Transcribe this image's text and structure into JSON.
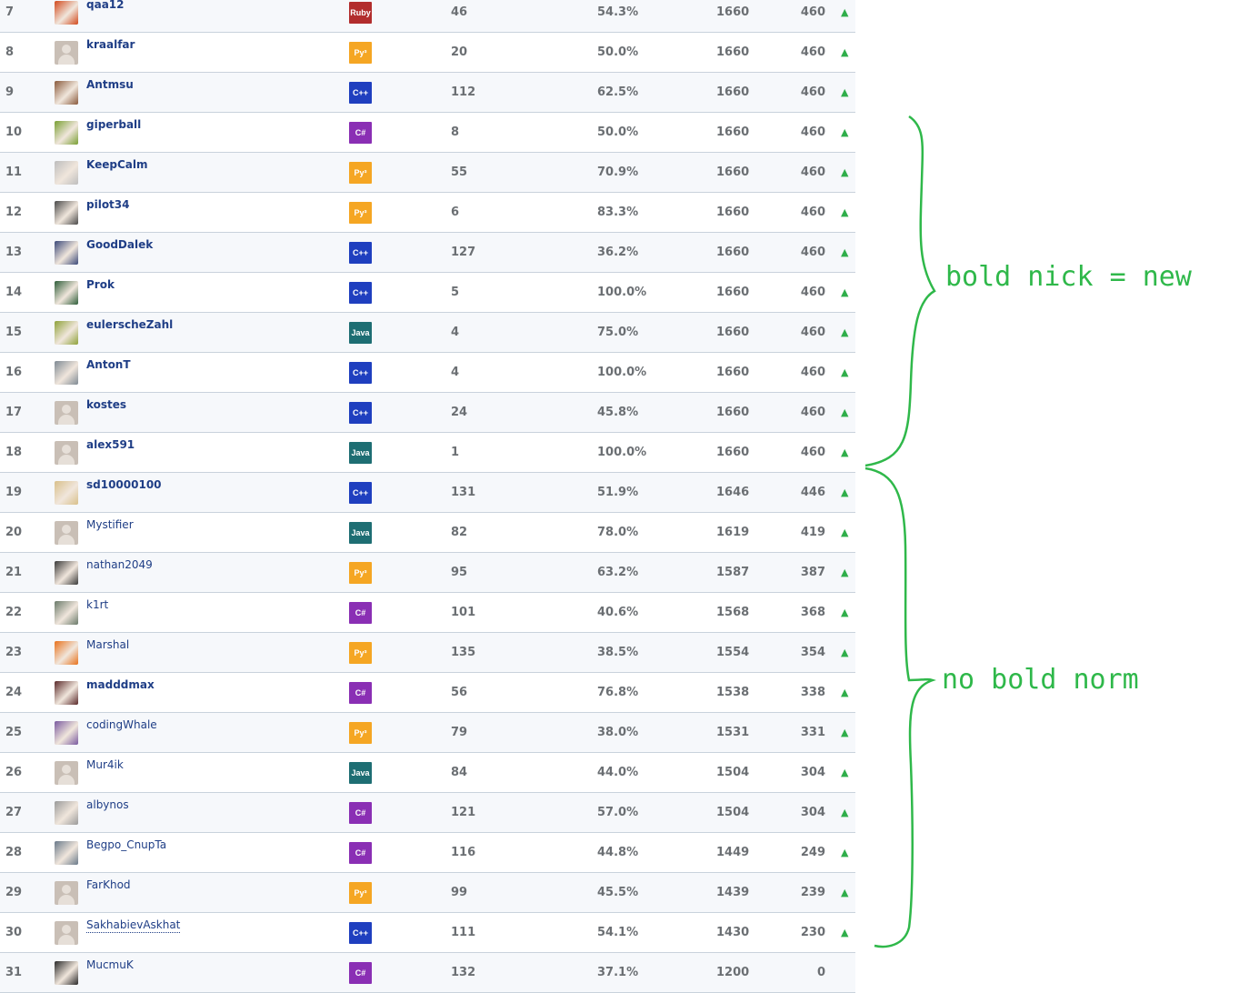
{
  "language_colors": {
    "Ruby": "#b22d2d",
    "Py": "#f5a623",
    "C++": "#1f3fbf",
    "C#": "#8a2fb4",
    "Java": "#1e6e73"
  },
  "rows": [
    {
      "rank": "7",
      "nick": "qaa12",
      "bold": true,
      "lang": "Ruby",
      "lang_label": "Ruby",
      "tasks": "46",
      "pct": "54.3%",
      "rating": "1660",
      "points": "460",
      "trend": "▲",
      "avatar": "dark-eye-avatar",
      "avatar_color": "#d24a1d"
    },
    {
      "rank": "8",
      "nick": "kraalfar",
      "bold": true,
      "lang": "Py",
      "lang_label": "Py³",
      "tasks": "20",
      "pct": "50.0%",
      "rating": "1660",
      "points": "460",
      "trend": "▲",
      "avatar": "default-avatar"
    },
    {
      "rank": "9",
      "nick": "Antmsu",
      "bold": true,
      "lang": "C++",
      "lang_label": "C++",
      "tasks": "112",
      "pct": "62.5%",
      "rating": "1660",
      "points": "460",
      "trend": "▲",
      "avatar": "photo-avatar",
      "avatar_color": "#8a5a3c"
    },
    {
      "rank": "10",
      "nick": "giperball",
      "bold": true,
      "lang": "C#",
      "lang_label": "C#",
      "tasks": "8",
      "pct": "50.0%",
      "rating": "1660",
      "points": "460",
      "trend": "▲",
      "avatar": "photo-avatar",
      "avatar_color": "#7aa034"
    },
    {
      "rank": "11",
      "nick": "KeepCalm",
      "bold": true,
      "lang": "Py",
      "lang_label": "Py³",
      "tasks": "55",
      "pct": "70.9%",
      "rating": "1660",
      "points": "460",
      "trend": "▲",
      "avatar": "photo-avatar",
      "avatar_color": "#bdbdbd"
    },
    {
      "rank": "12",
      "nick": "pilot34",
      "bold": true,
      "lang": "Py",
      "lang_label": "Py³",
      "tasks": "6",
      "pct": "83.3%",
      "rating": "1660",
      "points": "460",
      "trend": "▲",
      "avatar": "photo-avatar",
      "avatar_color": "#4a4a4a"
    },
    {
      "rank": "13",
      "nick": "GoodDalek",
      "bold": true,
      "lang": "C++",
      "lang_label": "C++",
      "tasks": "127",
      "pct": "36.2%",
      "rating": "1660",
      "points": "460",
      "trend": "▲",
      "avatar": "photo-avatar",
      "avatar_color": "#3c4a7a"
    },
    {
      "rank": "14",
      "nick": "Prok",
      "bold": true,
      "lang": "C++",
      "lang_label": "C++",
      "tasks": "5",
      "pct": "100.0%",
      "rating": "1660",
      "points": "460",
      "trend": "▲",
      "avatar": "photo-avatar",
      "avatar_color": "#2f5e3a"
    },
    {
      "rank": "15",
      "nick": "eulerscheZahl",
      "bold": true,
      "lang": "Java",
      "lang_label": "Java",
      "tasks": "4",
      "pct": "75.0%",
      "rating": "1660",
      "points": "460",
      "trend": "▲",
      "avatar": "photo-avatar",
      "avatar_color": "#8fa23a"
    },
    {
      "rank": "16",
      "nick": "AntonT",
      "bold": true,
      "lang": "C++",
      "lang_label": "C++",
      "tasks": "4",
      "pct": "100.0%",
      "rating": "1660",
      "points": "460",
      "trend": "▲",
      "avatar": "photo-avatar",
      "avatar_color": "#7f8a94"
    },
    {
      "rank": "17",
      "nick": "kostes",
      "bold": true,
      "lang": "C++",
      "lang_label": "C++",
      "tasks": "24",
      "pct": "45.8%",
      "rating": "1660",
      "points": "460",
      "trend": "▲",
      "avatar": "default-avatar"
    },
    {
      "rank": "18",
      "nick": "alex591",
      "bold": true,
      "lang": "Java",
      "lang_label": "Java",
      "tasks": "1",
      "pct": "100.0%",
      "rating": "1660",
      "points": "460",
      "trend": "▲",
      "avatar": "default-avatar"
    },
    {
      "rank": "19",
      "nick": "sd10000100",
      "bold": true,
      "lang": "C++",
      "lang_label": "C++",
      "tasks": "131",
      "pct": "51.9%",
      "rating": "1646",
      "points": "446",
      "trend": "▲",
      "avatar": "photo-avatar",
      "avatar_color": "#d9c08a"
    },
    {
      "rank": "20",
      "nick": "Mystifier",
      "bold": false,
      "lang": "Java",
      "lang_label": "Java",
      "tasks": "82",
      "pct": "78.0%",
      "rating": "1619",
      "points": "419",
      "trend": "▲",
      "avatar": "default-avatar"
    },
    {
      "rank": "21",
      "nick": "nathan2049",
      "bold": false,
      "lang": "Py",
      "lang_label": "Py³",
      "tasks": "95",
      "pct": "63.2%",
      "rating": "1587",
      "points": "387",
      "trend": "▲",
      "avatar": "photo-avatar",
      "avatar_color": "#3a3a3a"
    },
    {
      "rank": "22",
      "nick": "k1rt",
      "bold": false,
      "lang": "C#",
      "lang_label": "C#",
      "tasks": "101",
      "pct": "40.6%",
      "rating": "1568",
      "points": "368",
      "trend": "▲",
      "avatar": "photo-avatar",
      "avatar_color": "#6a7a6a"
    },
    {
      "rank": "23",
      "nick": "Marshal",
      "bold": false,
      "lang": "Py",
      "lang_label": "Py³",
      "tasks": "135",
      "pct": "38.5%",
      "rating": "1554",
      "points": "354",
      "trend": "▲",
      "avatar": "photo-avatar",
      "avatar_color": "#e8721c"
    },
    {
      "rank": "24",
      "nick": "madddmax",
      "bold": true,
      "lang": "C#",
      "lang_label": "C#",
      "tasks": "56",
      "pct": "76.8%",
      "rating": "1538",
      "points": "338",
      "trend": "▲",
      "avatar": "photo-avatar",
      "avatar_color": "#5a2a2a"
    },
    {
      "rank": "25",
      "nick": "codingWhale",
      "bold": false,
      "lang": "Py",
      "lang_label": "Py³",
      "tasks": "79",
      "pct": "38.0%",
      "rating": "1531",
      "points": "331",
      "trend": "▲",
      "avatar": "photo-avatar",
      "avatar_color": "#7a5aa0"
    },
    {
      "rank": "26",
      "nick": "Mur4ik",
      "bold": false,
      "lang": "Java",
      "lang_label": "Java",
      "tasks": "84",
      "pct": "44.0%",
      "rating": "1504",
      "points": "304",
      "trend": "▲",
      "avatar": "default-avatar"
    },
    {
      "rank": "27",
      "nick": "albynos",
      "bold": false,
      "lang": "C#",
      "lang_label": "C#",
      "tasks": "121",
      "pct": "57.0%",
      "rating": "1504",
      "points": "304",
      "trend": "▲",
      "avatar": "photo-avatar",
      "avatar_color": "#9a9a9a"
    },
    {
      "rank": "28",
      "nick": "Begpo_CnupTa",
      "bold": false,
      "lang": "C#",
      "lang_label": "C#",
      "tasks": "116",
      "pct": "44.8%",
      "rating": "1449",
      "points": "249",
      "trend": "▲",
      "avatar": "photo-avatar",
      "avatar_color": "#6a7a8a"
    },
    {
      "rank": "29",
      "nick": "FarKhod",
      "bold": false,
      "lang": "Py",
      "lang_label": "Py³",
      "tasks": "99",
      "pct": "45.5%",
      "rating": "1439",
      "points": "239",
      "trend": "▲",
      "avatar": "default-avatar"
    },
    {
      "rank": "30",
      "nick": "SakhabievAskhat",
      "bold": false,
      "dotted": true,
      "lang": "C++",
      "lang_label": "C++",
      "tasks": "111",
      "pct": "54.1%",
      "rating": "1430",
      "points": "230",
      "trend": "▲",
      "avatar": "default-avatar"
    },
    {
      "rank": "31",
      "nick": "MucmuK",
      "bold": false,
      "lang": "C#",
      "lang_label": "C#",
      "tasks": "132",
      "pct": "37.1%",
      "rating": "1200",
      "points": "0",
      "trend": "",
      "avatar": "photo-avatar",
      "avatar_color": "#2a2a2a"
    }
  ],
  "annotations": {
    "top": "bold nick = new",
    "bottom": "no bold norm",
    "color": "#2fb84a"
  }
}
